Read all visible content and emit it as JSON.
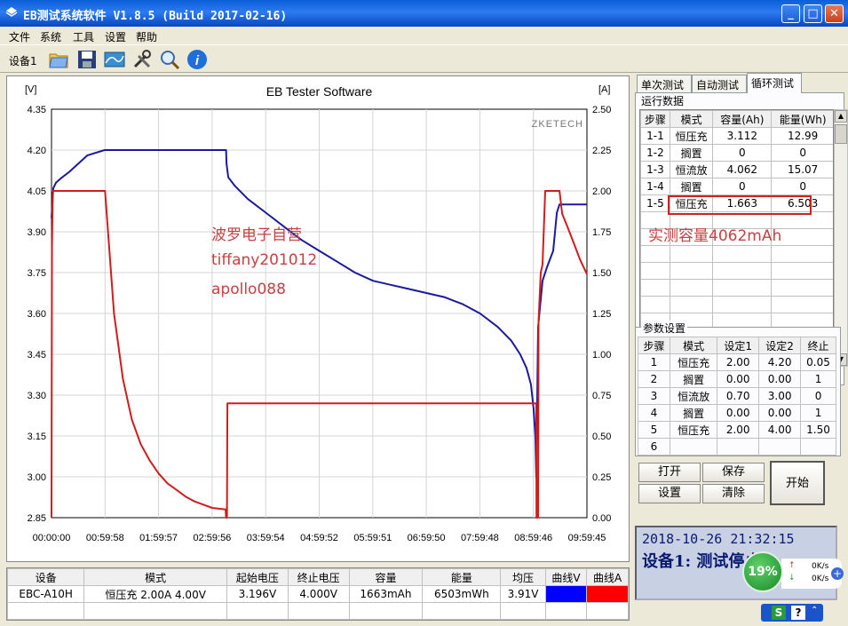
{
  "window": {
    "title": "EB测试系统软件 V1.8.5 (Build 2017-02-16)",
    "controls": {
      "minimize": "_",
      "maximize": "□",
      "close": "✕"
    }
  },
  "menu": [
    "文件",
    "系统",
    "工具",
    "设置",
    "帮助"
  ],
  "toolbar": {
    "device_label": "设备1",
    "icons": [
      "folder-icon",
      "save-icon",
      "chart-icon",
      "tools-icon",
      "search-icon",
      "info-icon"
    ]
  },
  "chart": {
    "title": "EB Tester Software",
    "watermark": "ZKETECH",
    "left_unit": "[V]",
    "right_unit": "[A]",
    "series_colors": {
      "voltage": "#1a1aa0",
      "current": "#d01c1c"
    }
  },
  "chart_data": {
    "type": "line",
    "title": "EB Tester Software",
    "left_axis": {
      "label": "[V]",
      "ylim": [
        2.85,
        4.35
      ],
      "ticks": [
        "4.35",
        "4.20",
        "4.05",
        "3.90",
        "3.75",
        "3.60",
        "3.45",
        "3.30",
        "3.15",
        "3.00",
        "2.85"
      ]
    },
    "right_axis": {
      "label": "[A]",
      "ylim": [
        0.0,
        2.5
      ],
      "ticks": [
        "2.50",
        "2.25",
        "2.00",
        "1.75",
        "1.50",
        "1.25",
        "1.00",
        "0.75",
        "0.50",
        "0.25",
        "0.00"
      ]
    },
    "x_ticks": [
      "00:00:00",
      "00:59:58",
      "01:59:57",
      "02:59:56",
      "03:59:54",
      "04:59:52",
      "05:59:51",
      "06:59:50",
      "07:59:48",
      "08:59:46",
      "09:59:45"
    ],
    "xlim_min": [
      0,
      599.75
    ],
    "grid": true,
    "series": [
      {
        "axis": "left",
        "color": "#1a1aa0",
        "points": [
          [
            0,
            3.95
          ],
          [
            2,
            4.06
          ],
          [
            5,
            4.08
          ],
          [
            10,
            4.095
          ],
          [
            20,
            4.12
          ],
          [
            30,
            4.15
          ],
          [
            40,
            4.18
          ],
          [
            59.5,
            4.2
          ],
          [
            120,
            4.2
          ],
          [
            180,
            4.2
          ],
          [
            195.5,
            4.2
          ],
          [
            196,
            4.15
          ],
          [
            198,
            4.1
          ],
          [
            205,
            4.07
          ],
          [
            220,
            4.02
          ],
          [
            240,
            3.97
          ],
          [
            260,
            3.92
          ],
          [
            280,
            3.87
          ],
          [
            300,
            3.83
          ],
          [
            320,
            3.79
          ],
          [
            340,
            3.75
          ],
          [
            360,
            3.72
          ],
          [
            380,
            3.705
          ],
          [
            400,
            3.69
          ],
          [
            420,
            3.675
          ],
          [
            440,
            3.66
          ],
          [
            460,
            3.635
          ],
          [
            480,
            3.6
          ],
          [
            500,
            3.55
          ],
          [
            515,
            3.5
          ],
          [
            525,
            3.45
          ],
          [
            532,
            3.4
          ],
          [
            537,
            3.34
          ],
          [
            540,
            3.25
          ],
          [
            542,
            3.15
          ],
          [
            543,
            3.0
          ],
          [
            545,
            3.55
          ],
          [
            550,
            3.72
          ],
          [
            555,
            3.77
          ],
          [
            562,
            3.83
          ],
          [
            566,
            3.97
          ],
          [
            569,
            4.0
          ],
          [
            575,
            4.0
          ],
          [
            599.75,
            4.0
          ]
        ]
      },
      {
        "axis": "right",
        "color": "#d01c1c",
        "points": [
          [
            0,
            0.0
          ],
          [
            0.5,
            1.65
          ],
          [
            1.5,
            2.0
          ],
          [
            58,
            2.0
          ],
          [
            60,
            2.0
          ],
          [
            62,
            1.85
          ],
          [
            70,
            1.25
          ],
          [
            80,
            0.85
          ],
          [
            90,
            0.6
          ],
          [
            100,
            0.45
          ],
          [
            110,
            0.35
          ],
          [
            120,
            0.27
          ],
          [
            130,
            0.21
          ],
          [
            140,
            0.17
          ],
          [
            150,
            0.13
          ],
          [
            160,
            0.1
          ],
          [
            170,
            0.08
          ],
          [
            180,
            0.06
          ],
          [
            195,
            0.05
          ],
          [
            195.5,
            0.0
          ],
          [
            196.5,
            0.0
          ],
          [
            197,
            0.7
          ],
          [
            543,
            0.7
          ],
          [
            543.3,
            0.0
          ],
          [
            545,
            0.0
          ],
          [
            545.5,
            1.2
          ],
          [
            548,
            1.5
          ],
          [
            550,
            1.55
          ],
          [
            553,
            2.0
          ],
          [
            569,
            2.0
          ],
          [
            572,
            1.86
          ],
          [
            578,
            1.78
          ],
          [
            585,
            1.68
          ],
          [
            592,
            1.58
          ],
          [
            599.75,
            1.49
          ]
        ]
      }
    ]
  },
  "overlay_text": [
    "波罗电子自营",
    "tiffany201012",
    "apollo088",
    "实测容量4062mAh"
  ],
  "right_panel": {
    "tabs": [
      "单次测试",
      "自动测试",
      "循环测试"
    ],
    "run_data": {
      "group_label": "运行数据",
      "headers": [
        "步骤",
        "模式",
        "容量(Ah)",
        "能量(Wh)"
      ],
      "rows": [
        [
          "1-1",
          "恒压充",
          "3.112",
          "12.99"
        ],
        [
          "1-2",
          "搁置",
          "0",
          "0"
        ],
        [
          "1-3",
          "恒流放",
          "4.062",
          "15.07"
        ],
        [
          "1-4",
          "搁置",
          "0",
          "0"
        ],
        [
          "1-5",
          "恒压充",
          "1.663",
          "6.503"
        ]
      ]
    },
    "params": {
      "group_label": "参数设置",
      "headers": [
        "步骤",
        "模式",
        "设定1",
        "设定2",
        "终止"
      ],
      "rows": [
        [
          "1",
          "恒压充",
          "2.00",
          "4.20",
          "0.05"
        ],
        [
          "2",
          "搁置",
          "0.00",
          "0.00",
          "1"
        ],
        [
          "3",
          "恒流放",
          "0.70",
          "3.00",
          "0"
        ],
        [
          "4",
          "搁置",
          "0.00",
          "0.00",
          "1"
        ],
        [
          "5",
          "恒压充",
          "2.00",
          "4.00",
          "1.50"
        ],
        [
          "6",
          "",
          "",
          "",
          ""
        ]
      ]
    },
    "buttons": {
      "open": "打开",
      "save": "保存",
      "settings": "设置",
      "clear": "清除",
      "start": "开始"
    },
    "status": {
      "datetime": "2018-10-26 21:32:15",
      "message": "设备1: 测试停止"
    }
  },
  "summary_table": {
    "headers": [
      "设备",
      "模式",
      "起始电压",
      "终止电压",
      "容量",
      "能量",
      "均压",
      "曲线V",
      "曲线A"
    ],
    "row": [
      "EBC-A10H",
      "恒压充  2.00A  4.00V",
      "3.196V",
      "4.000V",
      "1663mAh",
      "6503mWh",
      "3.91V"
    ],
    "curve_colors": [
      "#0000ff",
      "#ff0000"
    ]
  },
  "net_widget": {
    "percent": "19%",
    "up": "0K/s",
    "down": "0K/s",
    "add": "+"
  },
  "tray": {
    "s": "S",
    "help": "?"
  }
}
